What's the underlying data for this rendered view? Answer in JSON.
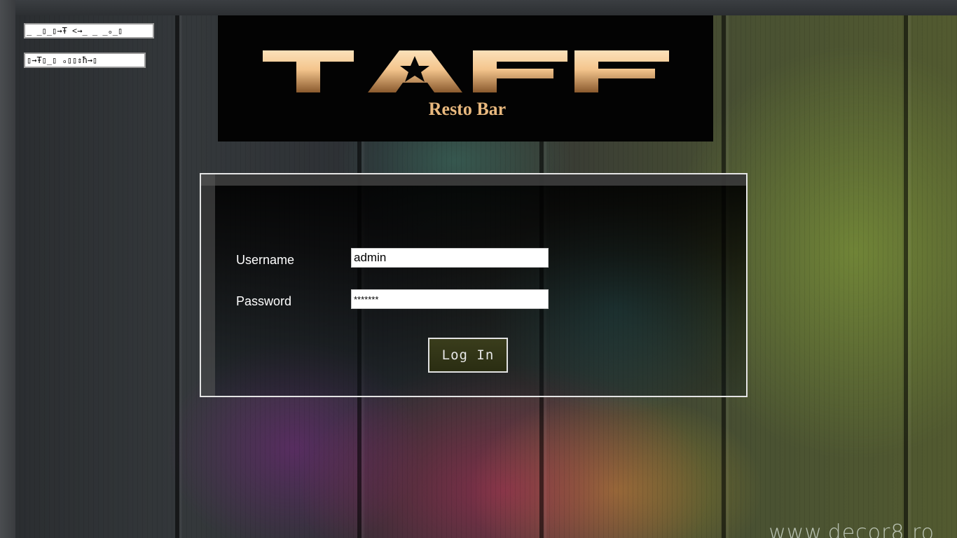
{
  "nav": {
    "links": [
      {
        "label": "_ _▯_▯→Ŧ ˂→_ _ _ₒ_▯"
      },
      {
        "label": "▯→Ŧ▯_▯ ₒ▯▯⇕ħ→▯"
      }
    ]
  },
  "header": {
    "logo_text": "TAFF",
    "subtitle": "Resto Bar"
  },
  "login": {
    "username_label": "Username",
    "username_value": "admin",
    "password_label": "Password",
    "password_value": "*******",
    "submit_label": "Log In"
  },
  "watermark": {
    "text": "www.decor8.ro"
  },
  "colors": {
    "header_bg": "#030303",
    "logo_gold": "#f4c58d",
    "subtitle_gold": "#e8b87e",
    "button_bg": "#323617"
  }
}
